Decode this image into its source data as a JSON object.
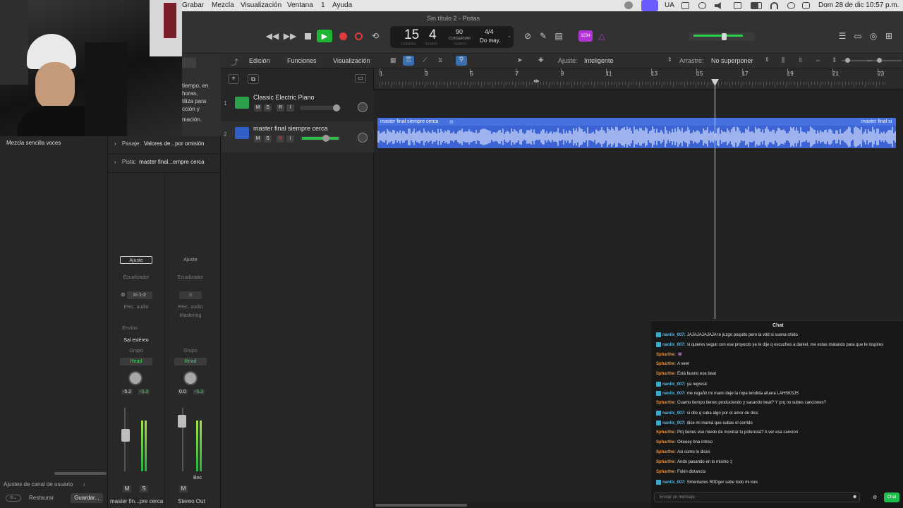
{
  "menubar": {
    "items": [
      "Grabar",
      "Mezcla",
      "Visualización",
      "Ventana",
      "1",
      "Ayuda"
    ],
    "window_title": "Sin título 2 - Pistas",
    "lang": "UA",
    "clock": "Dom 28 de dic  10:57 p.m."
  },
  "lcd": {
    "bar": "15",
    "beat": "4",
    "bar_sub": "COMPÁS",
    "beat_sub": "TIEMPO",
    "tempo": "90",
    "tempo_sub": "CONSERVAR",
    "tempo_sub2": "TEMPO",
    "signature": "4/4",
    "key": "Do may.",
    "count_in": "1234"
  },
  "inspector": {
    "overlay_text": [
      "tiempo, en",
      "horas,",
      "tiliza para",
      "cción y",
      "mación."
    ],
    "library_item": "Mezcla sencilla voces",
    "pasaje_label": "Pasaje:",
    "pasaje_value": "Valores de...por omisión",
    "pista_label": "Pista:",
    "pista_value": "master final...empre cerca",
    "footer_link": "Ajustes de canal de usuario",
    "restore": "Restaurar",
    "save": "Guardar...",
    "strip1": {
      "setting": "Ajuste",
      "eq": "Ecualizador",
      "input": "In 1-2",
      "fx": "Efec. audio",
      "send": "Envíos",
      "output": "Sal estéreo",
      "group": "Grupo",
      "automation": "Read",
      "pan_value": "-5.2",
      "peak": "-5.3",
      "mute": "M",
      "solo": "S",
      "name": "master fin...pre cerca"
    },
    "strip2": {
      "setting": "Ajuste",
      "eq": "Ecualizador",
      "fx": "Efec. audio",
      "fx2": "Mastering",
      "group": "Grupo",
      "automation": "Read",
      "pan_value": "0.0",
      "peak": "-5.3",
      "mute": "M",
      "bnc": "Bnc",
      "name": "Stereo Out"
    }
  },
  "tracks_toolbar": {
    "edit": "Edición",
    "functions": "Funciones",
    "view": "Visualización",
    "snap_label": "Ajuste:",
    "snap_value": "Inteligente",
    "drag_label": "Arrastre:",
    "drag_value": "No superponer"
  },
  "ruler": {
    "marks": [
      "1",
      "3",
      "5",
      "7",
      "9",
      "11",
      "13",
      "15",
      "17",
      "19",
      "21",
      "23"
    ]
  },
  "tracks": [
    {
      "number": "1",
      "name": "Classic Electric Piano",
      "m": "M",
      "s": "S",
      "r": "R",
      "i": "I"
    },
    {
      "number": "2",
      "name": "master final siempre cerca",
      "m": "M",
      "s": "S",
      "r": "R",
      "i": "I"
    }
  ],
  "region": {
    "name": "master final siempre cerca",
    "name_end": "master final si"
  },
  "chat": {
    "title": "Chat",
    "lines": [
      {
        "user": "nanilx_007:",
        "text": "JAJAJAJAJAJA te juzgo poquito pero la vdd si suena chido",
        "color": "#5cb8e6",
        "badge": true
      },
      {
        "user": "nanilx_007:",
        "text": "si quieres seguir con ese proyecto ya te dije q escuches a daniel, me estas matando para que te inspires",
        "color": "#5cb8e6",
        "badge": true
      },
      {
        "user": "Spharthe:",
        "text": "👾",
        "color": "#e8923c",
        "badge": false
      },
      {
        "user": "Spharthe:",
        "text": "A veer",
        "color": "#e8923c",
        "badge": false
      },
      {
        "user": "Spharthe:",
        "text": "Está bueno ese beat",
        "color": "#e8923c",
        "badge": false
      },
      {
        "user": "nanilx_007:",
        "text": "ya regresé",
        "color": "#5cb8e6",
        "badge": true
      },
      {
        "user": "nanilx_007:",
        "text": "me regañó mi mami deje la ropa tendida afuera LAHSKSJS",
        "color": "#5cb8e6",
        "badge": true
      },
      {
        "user": "Spharthe:",
        "text": "Cuanto tiempo tienes produciendo y sacando beat? Y prq no subes canciones?",
        "color": "#e8923c",
        "badge": false
      },
      {
        "user": "nanilx_007:",
        "text": "si dile q suba algo por el amor de dios",
        "color": "#5cb8e6",
        "badge": true
      },
      {
        "user": "nanilx_007:",
        "text": "dice mi mamá que subas el corrido",
        "color": "#5cb8e6",
        "badge": true
      },
      {
        "user": "Spharthe:",
        "text": "Prq tienes ese miedo de mostrar tu potencial? A ver esa cancion",
        "color": "#e8923c",
        "badge": false
      },
      {
        "user": "Spharthe:",
        "text": "Okeeey bna intnso",
        "color": "#e8923c",
        "badge": false
      },
      {
        "user": "Spharthe:",
        "text": "Asi como lo dices",
        "color": "#e8923c",
        "badge": false
      },
      {
        "user": "Spharthe:",
        "text": "Ando pasando en lo mismo :(",
        "color": "#e8923c",
        "badge": false
      },
      {
        "user": "Spharthe:",
        "text": "Fokin distancia",
        "color": "#e8923c",
        "badge": false
      },
      {
        "user": "nanilx_007:",
        "text": "Smentarios R0Dger sabe todo mi lore",
        "color": "#5cb8e6",
        "badge": true
      }
    ],
    "placeholder": "Enviar un mensaje",
    "send": "Chat"
  }
}
